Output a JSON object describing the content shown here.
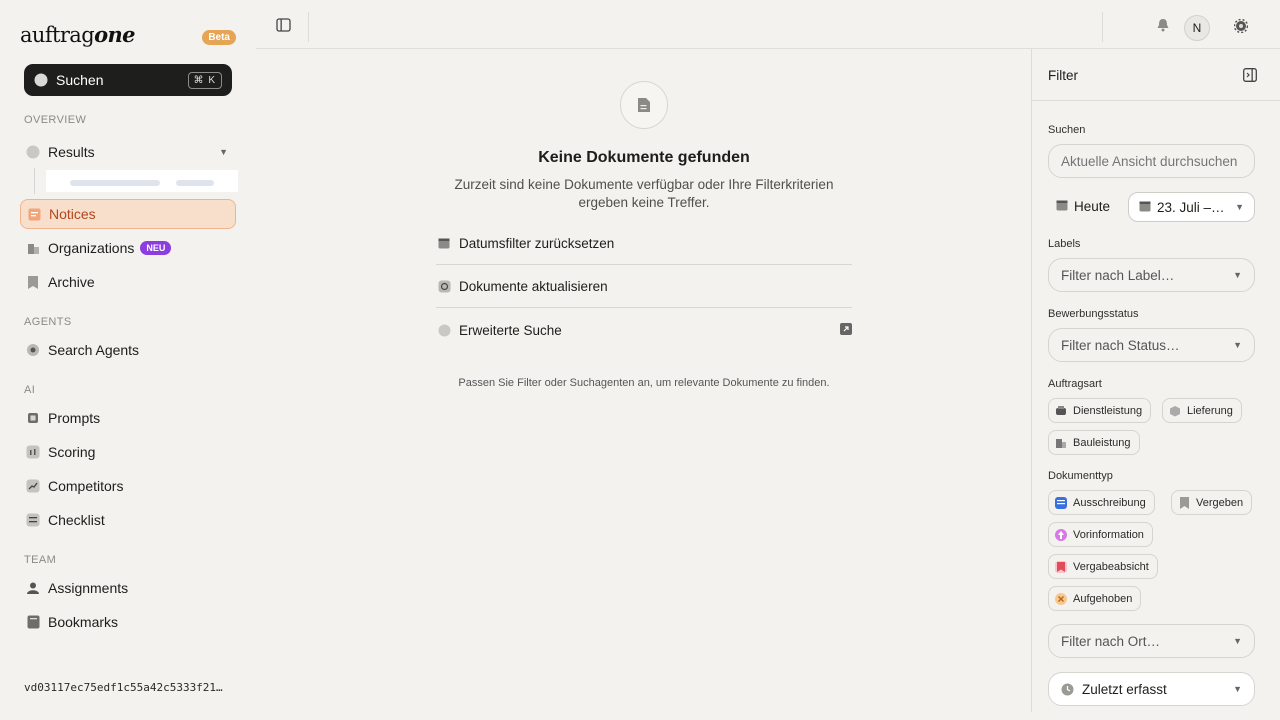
{
  "brand": {
    "logo_light": "auftrag",
    "logo_bold": "one",
    "beta": "Beta"
  },
  "search": {
    "label": "Suchen",
    "shortcut": "⌘ K"
  },
  "sections": {
    "overview": "OVERVIEW",
    "agents": "AGENTS",
    "ai": "AI",
    "team": "TEAM"
  },
  "nav": {
    "results": "Results",
    "notices": "Notices",
    "organizations": "Organizations",
    "organizations_badge": "NEU",
    "archive": "Archive",
    "search_agents": "Search Agents",
    "prompts": "Prompts",
    "scoring": "Scoring",
    "competitors": "Competitors",
    "checklist": "Checklist",
    "assignments": "Assignments",
    "bookmarks": "Bookmarks"
  },
  "version": "vd03117ec75edf1c55a42c5333f21…",
  "topbar": {
    "avatar": "N"
  },
  "empty": {
    "title": "Keine Dokumente gefunden",
    "description": "Zurzeit sind keine Dokumente verfügbar oder Ihre Filterkriterien ergeben keine Treffer.",
    "actions": {
      "reset_date": "Datumsfilter zurücksetzen",
      "refresh": "Dokumente aktualisieren",
      "advanced": "Erweiterte Suche"
    },
    "hint": "Passen Sie Filter oder Suchagenten an, um relevante Dokumente zu finden."
  },
  "filter": {
    "title": "Filter",
    "search_label": "Suchen",
    "search_placeholder": "Aktuelle Ansicht durchsuchen u",
    "today": "Heute",
    "date_range": "23. Juli –…",
    "labels_label": "Labels",
    "labels_placeholder": "Filter nach Label…",
    "status_label": "Bewerbungsstatus",
    "status_placeholder": "Filter nach Status…",
    "order_type_label": "Auftragsart",
    "order_types": {
      "service": "Dienstleistung",
      "delivery": "Lieferung",
      "construction": "Bauleistung"
    },
    "doc_type_label": "Dokumenttyp",
    "doc_types": {
      "tender": "Ausschreibung",
      "awarded": "Vergeben",
      "prior_info": "Vorinformation",
      "award_intent": "Vergabeabsicht",
      "cancelled": "Aufgehoben"
    },
    "location_placeholder": "Filter nach Ort…",
    "sort": "Zuletzt erfasst"
  },
  "colors": {
    "accent": "#f0b48d",
    "active_text": "#b2461d",
    "badge_purple": "#8b3de0",
    "beta": "#e6a455"
  }
}
